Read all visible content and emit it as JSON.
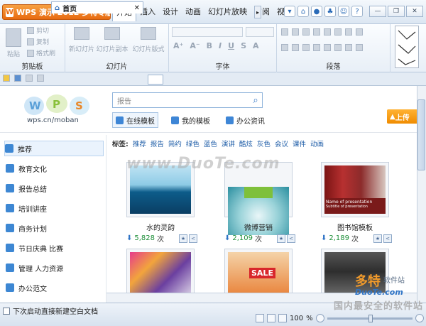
{
  "app": {
    "title_button": "WPS 演示 2012 多特专版",
    "tabs": [
      "开始",
      "插入",
      "设计",
      "动画",
      "幻灯片放映",
      "审阅",
      "视"
    ],
    "active_tab": "开始"
  },
  "ribbon": {
    "groups": [
      {
        "name": "剪贴板",
        "items": [
          "粘贴",
          "剪切",
          "复制",
          "格式刷"
        ]
      },
      {
        "name": "幻灯片",
        "items": [
          "新幻灯片",
          "幻灯片副本",
          "幻灯片版式"
        ]
      },
      {
        "name": "字体",
        "items": [
          "A⁺",
          "A⁻",
          "B",
          "I",
          "U",
          "S",
          "A"
        ]
      },
      {
        "name": "段落",
        "items": []
      }
    ]
  },
  "doc_tab": {
    "label": "首页"
  },
  "header": {
    "logo_text": "WPS",
    "url": "wps.cn/moban",
    "search_placeholder": "报告",
    "nav_tabs": [
      "在线模板",
      "我的模板",
      "办公资讯"
    ],
    "upload_label": "上传"
  },
  "sidebar": {
    "items": [
      "推荐",
      "教育文化",
      "报告总结",
      "培训讲座",
      "商务计划",
      "节日庆典 比赛",
      "管理 人力资源",
      "办公范文"
    ]
  },
  "tags": {
    "label": "标签:",
    "items": [
      "推荐",
      "报告",
      "简约",
      "绿色",
      "蓝色",
      "演讲",
      "酷炫",
      "灰色",
      "会议",
      "课件",
      "动画"
    ]
  },
  "cards": [
    {
      "title": "水的灵韵",
      "downloads": "5,828",
      "unit": "次"
    },
    {
      "title": "微博营销",
      "downloads": "2,109",
      "unit": "次"
    },
    {
      "title": "图书馆模板",
      "downloads": "2,189",
      "unit": "次"
    },
    {
      "title": "",
      "downloads": "",
      "unit": ""
    },
    {
      "title": "",
      "downloads": "",
      "unit": ""
    },
    {
      "title": "",
      "downloads": "",
      "unit": ""
    }
  ],
  "card3_caption": "Name of presentation",
  "card3_sub": "Subtitle of presentation",
  "card5_text": "SALE",
  "status": {
    "startup_check": "下次启动直接新建空白文档",
    "zoom": "100",
    "zoom_unit": "%"
  },
  "watermark": {
    "main": "www.DuoTe.com",
    "logo_cn": "多特",
    "logo_sub": "软件站",
    "logo_en": "DuoTe.com",
    "tagline": "国内最安全的软件站"
  },
  "colors": {
    "accent": "#e86a10",
    "link": "#1f5ea8",
    "count": "#1f8f3a"
  }
}
